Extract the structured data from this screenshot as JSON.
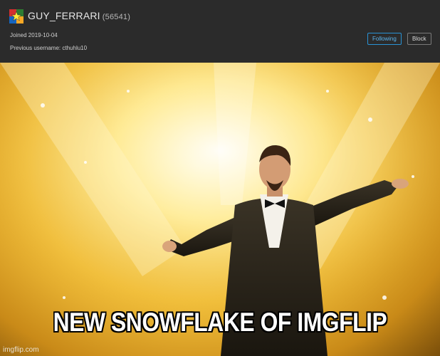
{
  "profile": {
    "username": "GUY_FERRARI",
    "points": "(56541)",
    "joined": "Joined 2019-10-04",
    "previous_username": "Previous username: cthuhlu10",
    "following_label": "Following",
    "block_label": "Block",
    "avatar_icon": "star-flag-avatar-icon",
    "colors": {
      "header_bg": "#2b2b2b",
      "following_border": "#2a93d5"
    }
  },
  "meme": {
    "image_icon": "man-in-tuxedo-arms-outstretched-image",
    "caption": "NEW SNOWFLAKE OF IMGFLIP",
    "watermark": "imgflip.com"
  }
}
